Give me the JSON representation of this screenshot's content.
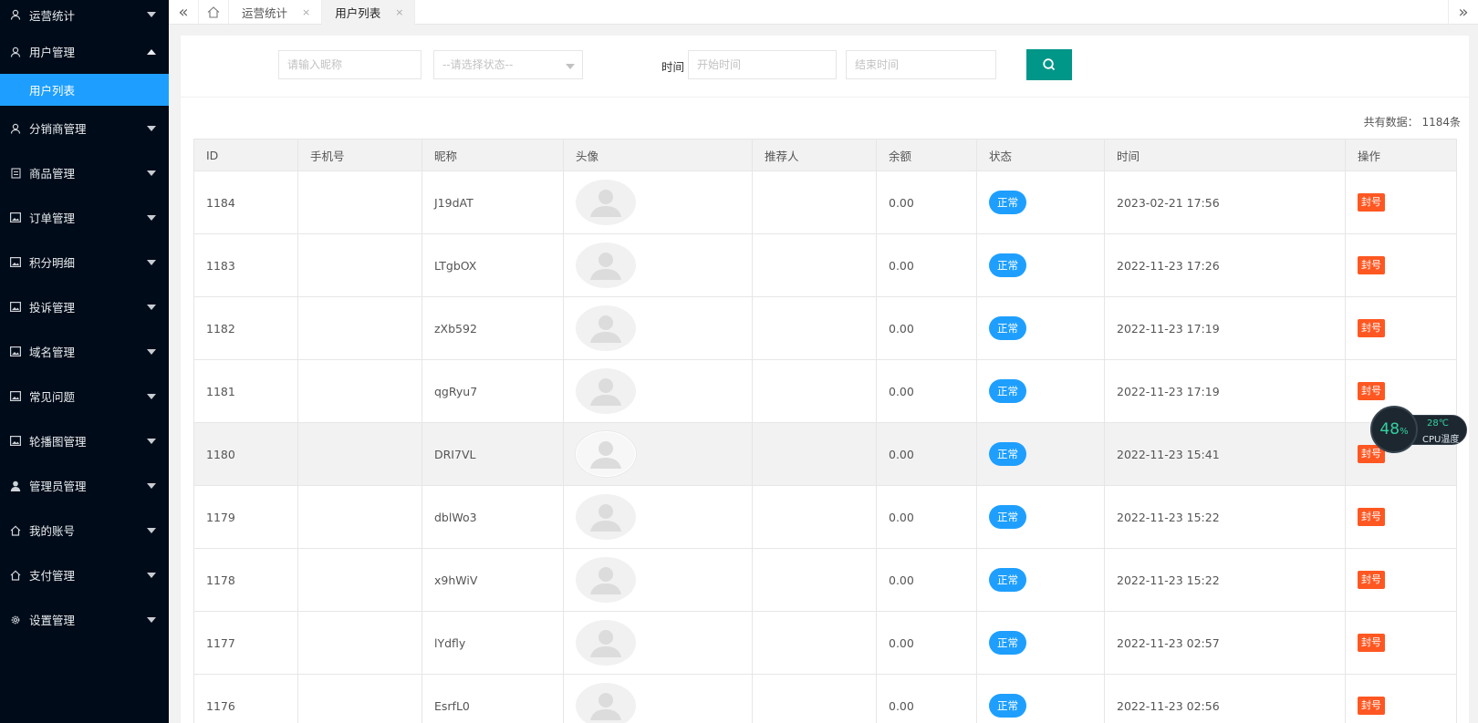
{
  "sidebar": {
    "items": [
      {
        "label": "运营统计",
        "icon": "user-icon"
      },
      {
        "label": "用户管理",
        "icon": "user-icon",
        "expanded": true,
        "children": [
          "用户列表"
        ]
      },
      {
        "label": "分销商管理",
        "icon": "user-icon"
      },
      {
        "label": "商品管理",
        "icon": "document-icon"
      },
      {
        "label": "订单管理",
        "icon": "image-icon"
      },
      {
        "label": "积分明细",
        "icon": "image-icon"
      },
      {
        "label": "投诉管理",
        "icon": "image-icon"
      },
      {
        "label": "域名管理",
        "icon": "image-icon"
      },
      {
        "label": "常见问题",
        "icon": "image-icon"
      },
      {
        "label": "轮播图管理",
        "icon": "image-icon"
      },
      {
        "label": "管理员管理",
        "icon": "person-icon"
      },
      {
        "label": "我的账号",
        "icon": "home-icon"
      },
      {
        "label": "支付管理",
        "icon": "home-icon"
      },
      {
        "label": "设置管理",
        "icon": "gear-icon"
      }
    ]
  },
  "tabs": {
    "items": [
      {
        "label": "运营统计",
        "close": "×"
      },
      {
        "label": "用户列表",
        "close": "×"
      }
    ]
  },
  "search": {
    "nickname_placeholder": "请输入昵称",
    "status_placeholder": "--请选择状态--",
    "time_label": "时间",
    "start_placeholder": "开始时间",
    "end_placeholder": "结束时间"
  },
  "total_text": "共有数据： 1184条",
  "table": {
    "headers": [
      "ID",
      "手机号",
      "昵称",
      "头像",
      "推荐人",
      "余额",
      "状态",
      "时间",
      "操作"
    ],
    "rows": [
      {
        "id": "1184",
        "phone": "",
        "nickname": "J19dAT",
        "referrer": "",
        "balance": "0.00",
        "status": "正常",
        "time": "2023-02-21 17:56",
        "action": "封号"
      },
      {
        "id": "1183",
        "phone": "",
        "nickname": "LTgbOX",
        "referrer": "",
        "balance": "0.00",
        "status": "正常",
        "time": "2022-11-23 17:26",
        "action": "封号"
      },
      {
        "id": "1182",
        "phone": "",
        "nickname": "zXb592",
        "referrer": "",
        "balance": "0.00",
        "status": "正常",
        "time": "2022-11-23 17:19",
        "action": "封号"
      },
      {
        "id": "1181",
        "phone": "",
        "nickname": "qgRyu7",
        "referrer": "",
        "balance": "0.00",
        "status": "正常",
        "time": "2022-11-23 17:19",
        "action": "封号"
      },
      {
        "id": "1180",
        "phone": "",
        "nickname": "DRI7VL",
        "referrer": "",
        "balance": "0.00",
        "status": "正常",
        "time": "2022-11-23 15:41",
        "action": "封号"
      },
      {
        "id": "1179",
        "phone": "",
        "nickname": "dblWo3",
        "referrer": "",
        "balance": "0.00",
        "status": "正常",
        "time": "2022-11-23 15:22",
        "action": "封号"
      },
      {
        "id": "1178",
        "phone": "",
        "nickname": "x9hWiV",
        "referrer": "",
        "balance": "0.00",
        "status": "正常",
        "time": "2022-11-23 15:22",
        "action": "封号"
      },
      {
        "id": "1177",
        "phone": "",
        "nickname": "lYdfly",
        "referrer": "",
        "balance": "0.00",
        "status": "正常",
        "time": "2022-11-23 02:57",
        "action": "封号"
      },
      {
        "id": "1176",
        "phone": "",
        "nickname": "EsrfL0",
        "referrer": "",
        "balance": "0.00",
        "status": "正常",
        "time": "2022-11-23 02:56",
        "action": "封号"
      }
    ]
  },
  "cpu_widget": {
    "percent": "48",
    "percent_unit": "%",
    "temp": "28℃",
    "label": "CPU温度"
  }
}
